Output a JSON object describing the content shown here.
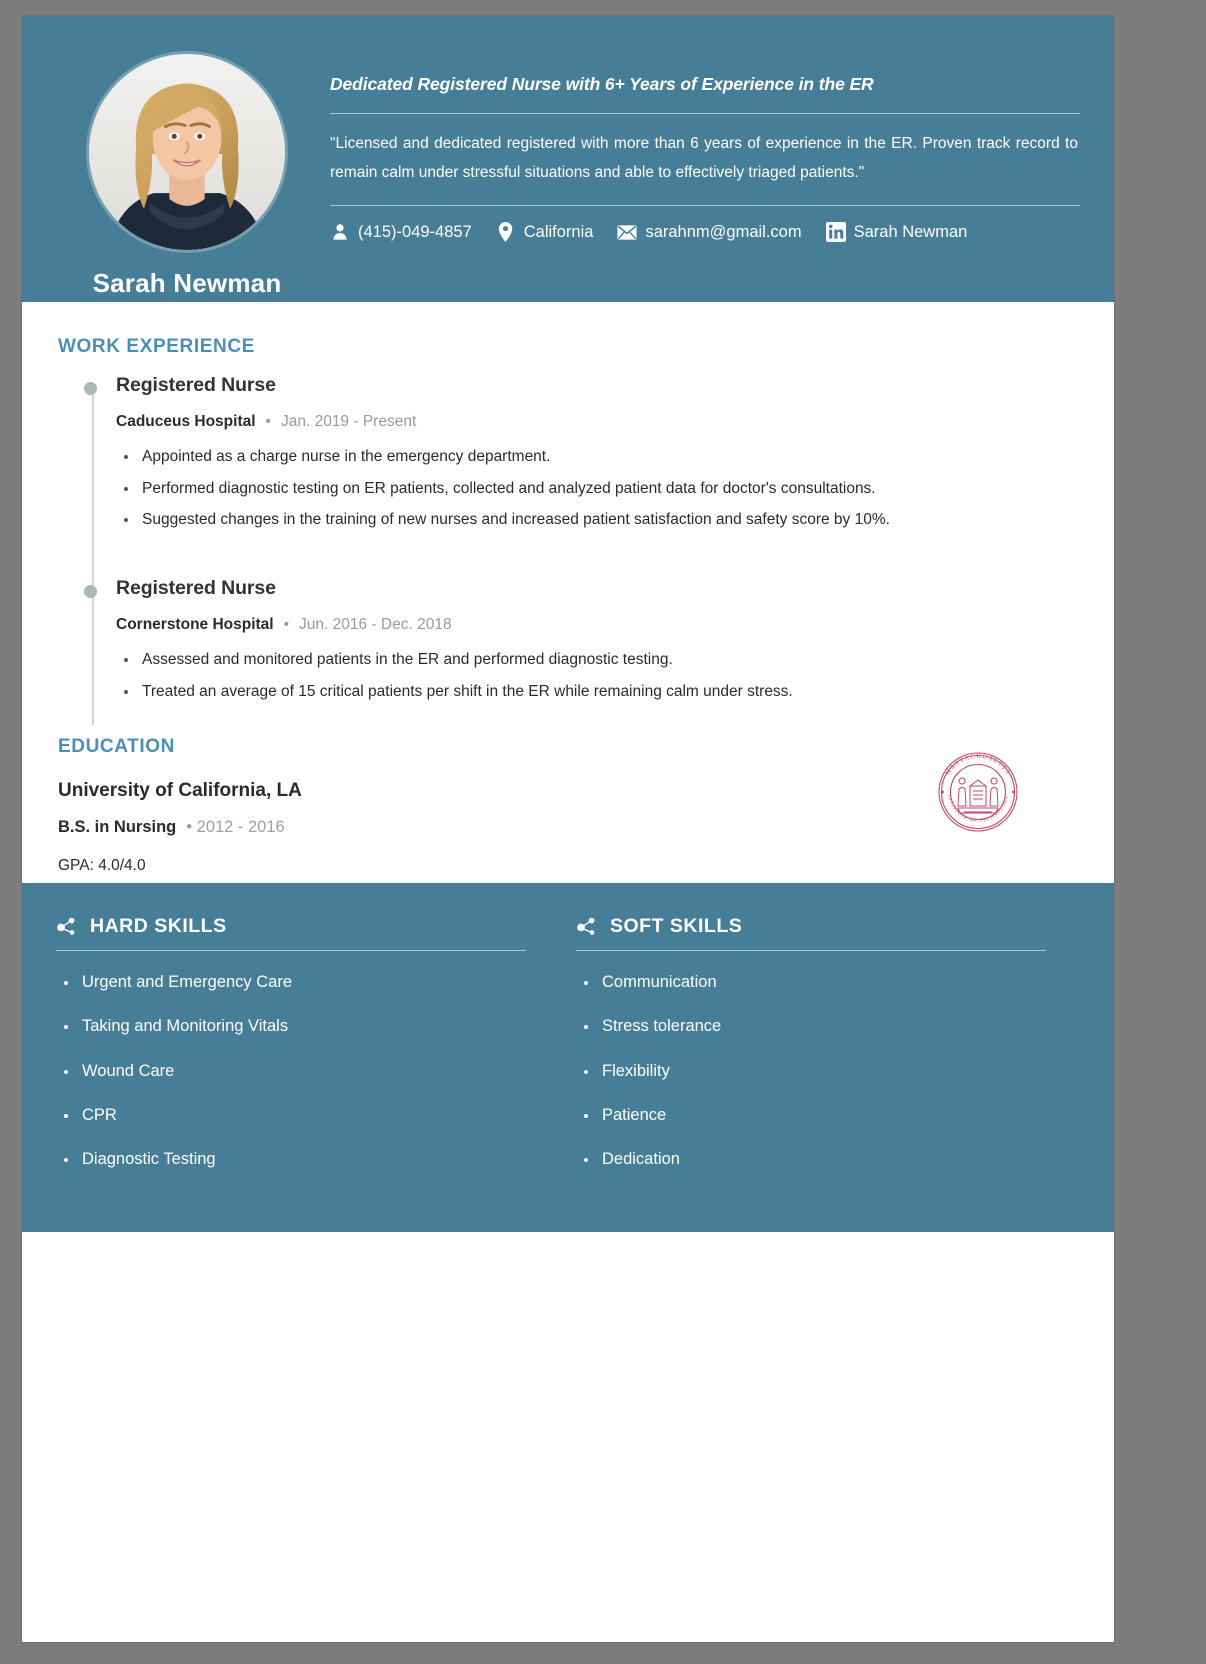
{
  "colors": {
    "accent_blue": "#477e97",
    "section_heading": "#4a90b4",
    "timeline_dot": "#a8b8b4",
    "muted_text": "#9a9a9a",
    "seal_crimson": "#c2476a"
  },
  "header": {
    "name": "Sarah Newman",
    "headline": "Dedicated Registered Nurse with 6+ Years of Experience in the ER",
    "summary": "\"Licensed and dedicated registered with more than 6 years of experience in the ER. Proven track record to remain calm under stressful situations and able to effectively triaged patients.\"",
    "avatar_alt": "profile-photo",
    "contacts": [
      {
        "icon": "user-icon",
        "text": "(415)-049-4857"
      },
      {
        "icon": "location-pin-icon",
        "text": "California"
      },
      {
        "icon": "envelope-icon",
        "text": "sarahnm@gmail.com"
      },
      {
        "icon": "linkedin-icon",
        "text": "Sarah Newman"
      }
    ]
  },
  "work_experience": {
    "title": "WORK EXPERIENCE",
    "jobs": [
      {
        "title": "Registered Nurse",
        "company": "Caduceus Hospital",
        "separator": "•",
        "dates": "Jan. 2019 - Present",
        "bullets": [
          "Appointed as a charge nurse in the emergency department.",
          "Performed diagnostic testing on ER patients, collected and analyzed patient data for doctor's consultations.",
          "Suggested changes in the training of new nurses and increased patient satisfaction and safety score by 10%."
        ]
      },
      {
        "title": "Registered Nurse",
        "company": "Cornerstone Hospital",
        "separator": "•",
        "dates": "Jun. 2016 - Dec. 2018",
        "bullets": [
          "Assessed and monitored patients in the ER and performed diagnostic testing.",
          "Treated an average of 15 critical patients per shift in the ER while remaining calm under stress."
        ]
      }
    ]
  },
  "education": {
    "title": "EDUCATION",
    "school": "University of California, LA",
    "degree": "B.S. in Nursing",
    "separator": "•",
    "dates": "2012 - 2016",
    "gpa": "GPA: 4.0/4.0",
    "seal": {
      "icon": "university-seal-icon",
      "outer_text": "MASSACHUSETTS",
      "inner_text": "INSTITUTE OF TECHNOLOGY"
    }
  },
  "skills": {
    "hard": {
      "icon": "skill-node-icon",
      "title": "HARD SKILLS",
      "items": [
        "Urgent and Emergency Care",
        "Taking and Monitoring Vitals",
        "Wound Care",
        "CPR",
        "Diagnostic Testing"
      ]
    },
    "soft": {
      "icon": "skill-node-icon",
      "title": "SOFT SKILLS",
      "items": [
        "Communication",
        "Stress tolerance",
        "Flexibility",
        "Patience",
        "Dedication"
      ]
    }
  }
}
